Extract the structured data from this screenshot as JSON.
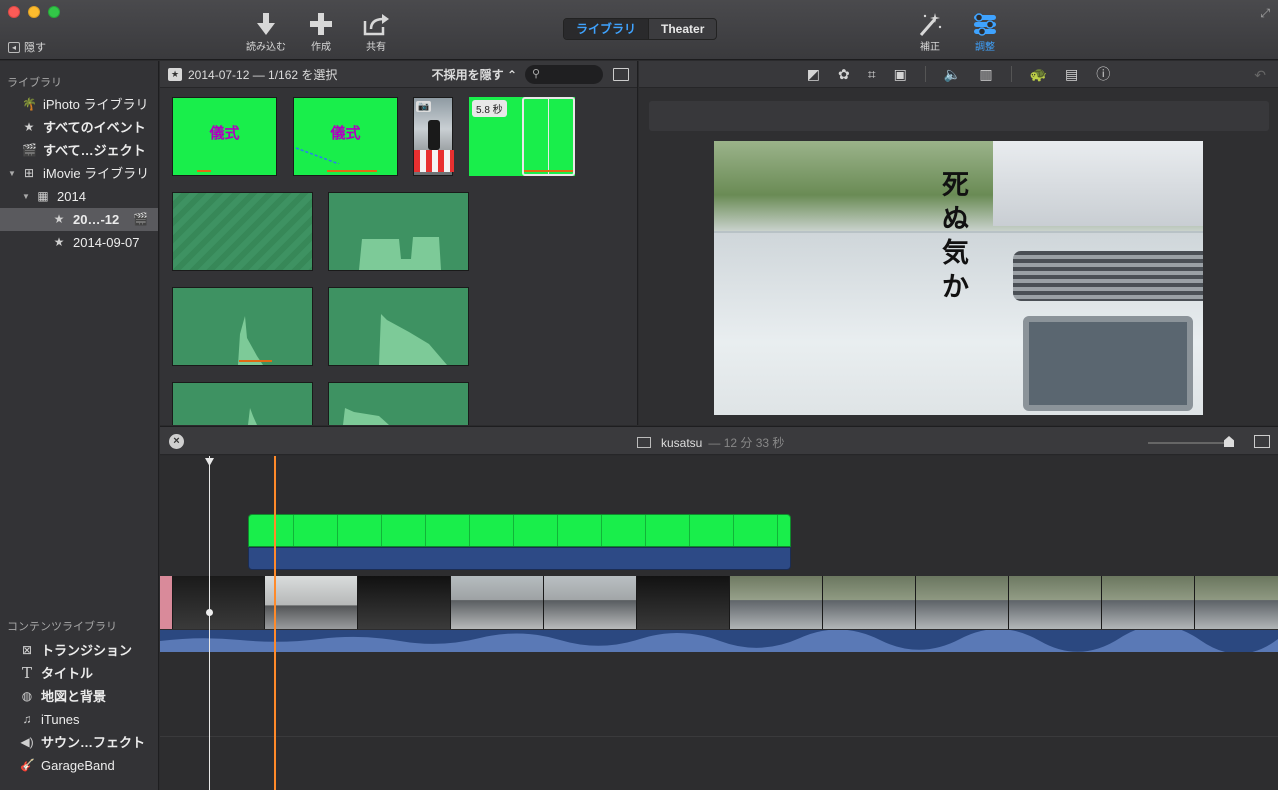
{
  "toolbar": {
    "hide_label": "隠す",
    "import_label": "読み込む",
    "create_label": "作成",
    "share_label": "共有",
    "seg_library": "ライブラリ",
    "seg_theater": "Theater",
    "enhance_label": "補正",
    "adjust_label": "調整"
  },
  "sidebar": {
    "library_header": "ライブラリ",
    "items": [
      {
        "label": "iPhoto ライブラリ",
        "icon": "palm-tree-icon"
      },
      {
        "label": "すべてのイベント",
        "icon": "star-icon"
      },
      {
        "label": "すべて…ジェクト",
        "icon": "clapper-icon"
      },
      {
        "label": "iMovie ライブラリ",
        "icon": "grid-icon"
      },
      {
        "label": "2014",
        "icon": "calendar-icon"
      },
      {
        "label": "20…-12",
        "icon": "star-icon"
      },
      {
        "label": "2014-09-07",
        "icon": "star-icon"
      }
    ],
    "content_header": "コンテンツライブラリ",
    "content_items": [
      {
        "label": "トランジション",
        "icon": "transition-icon"
      },
      {
        "label": "タイトル",
        "icon": "title-icon"
      },
      {
        "label": "地図と背景",
        "icon": "globe-icon"
      },
      {
        "label": "iTunes",
        "icon": "music-note-icon"
      },
      {
        "label": "サウン…フェクト",
        "icon": "speaker-icon"
      },
      {
        "label": "GarageBand",
        "icon": "guitar-icon"
      }
    ]
  },
  "browser": {
    "selection_text": "2014-07-12 — 1/162 を選択",
    "filter_label": "不採用を隠す ⌃",
    "search_placeholder": "",
    "clips": [
      {
        "kind": "title",
        "text": "儀式"
      },
      {
        "kind": "title",
        "text": "儀式"
      },
      {
        "kind": "photo"
      },
      {
        "kind": "title",
        "badge": "5.8 秒"
      },
      {
        "kind": "title-selected"
      }
    ]
  },
  "timeline": {
    "project_name": "kusatsu",
    "duration": "— 12 分 33 秒"
  },
  "viewer": {
    "overlay_text": "死ぬ気か"
  },
  "colors": {
    "accent": "#3fa3ff",
    "clip_green": "#19ee4b",
    "audio_green": "#3e9262",
    "skimmer": "#ff8a2a",
    "title_purple": "#b000c0"
  }
}
